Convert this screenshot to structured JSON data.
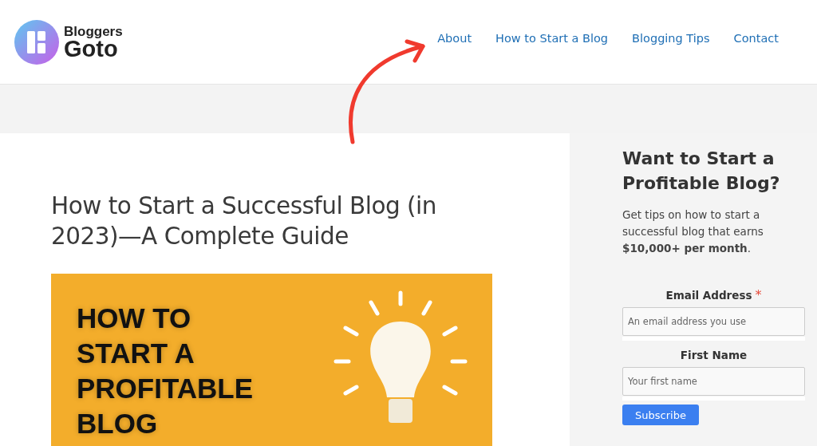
{
  "header": {
    "logo": {
      "line_1": "Bloggers",
      "line_2": "Goto"
    },
    "nav": [
      {
        "label": "About"
      },
      {
        "label": "How to Start a Blog"
      },
      {
        "label": "Blogging Tips"
      },
      {
        "label": "Contact"
      }
    ]
  },
  "article": {
    "title": "How to Start a Successful Blog (in 2023)—A Complete Guide",
    "featured_image": {
      "lines": [
        "HOW TO",
        "START A",
        "PROFITABLE",
        "BLOG"
      ]
    }
  },
  "sidebar": {
    "heading": "Want to Start a Profitable Blog?",
    "text": "Get tips on how to start a successful blog that earns **$10,000+ per month**.",
    "fields": [
      {
        "label": "Email Address",
        "required_mark": "*",
        "placeholder": "An email address you use"
      },
      {
        "label": "First Name",
        "placeholder": "Your first name"
      }
    ],
    "button": "Subscribe"
  }
}
